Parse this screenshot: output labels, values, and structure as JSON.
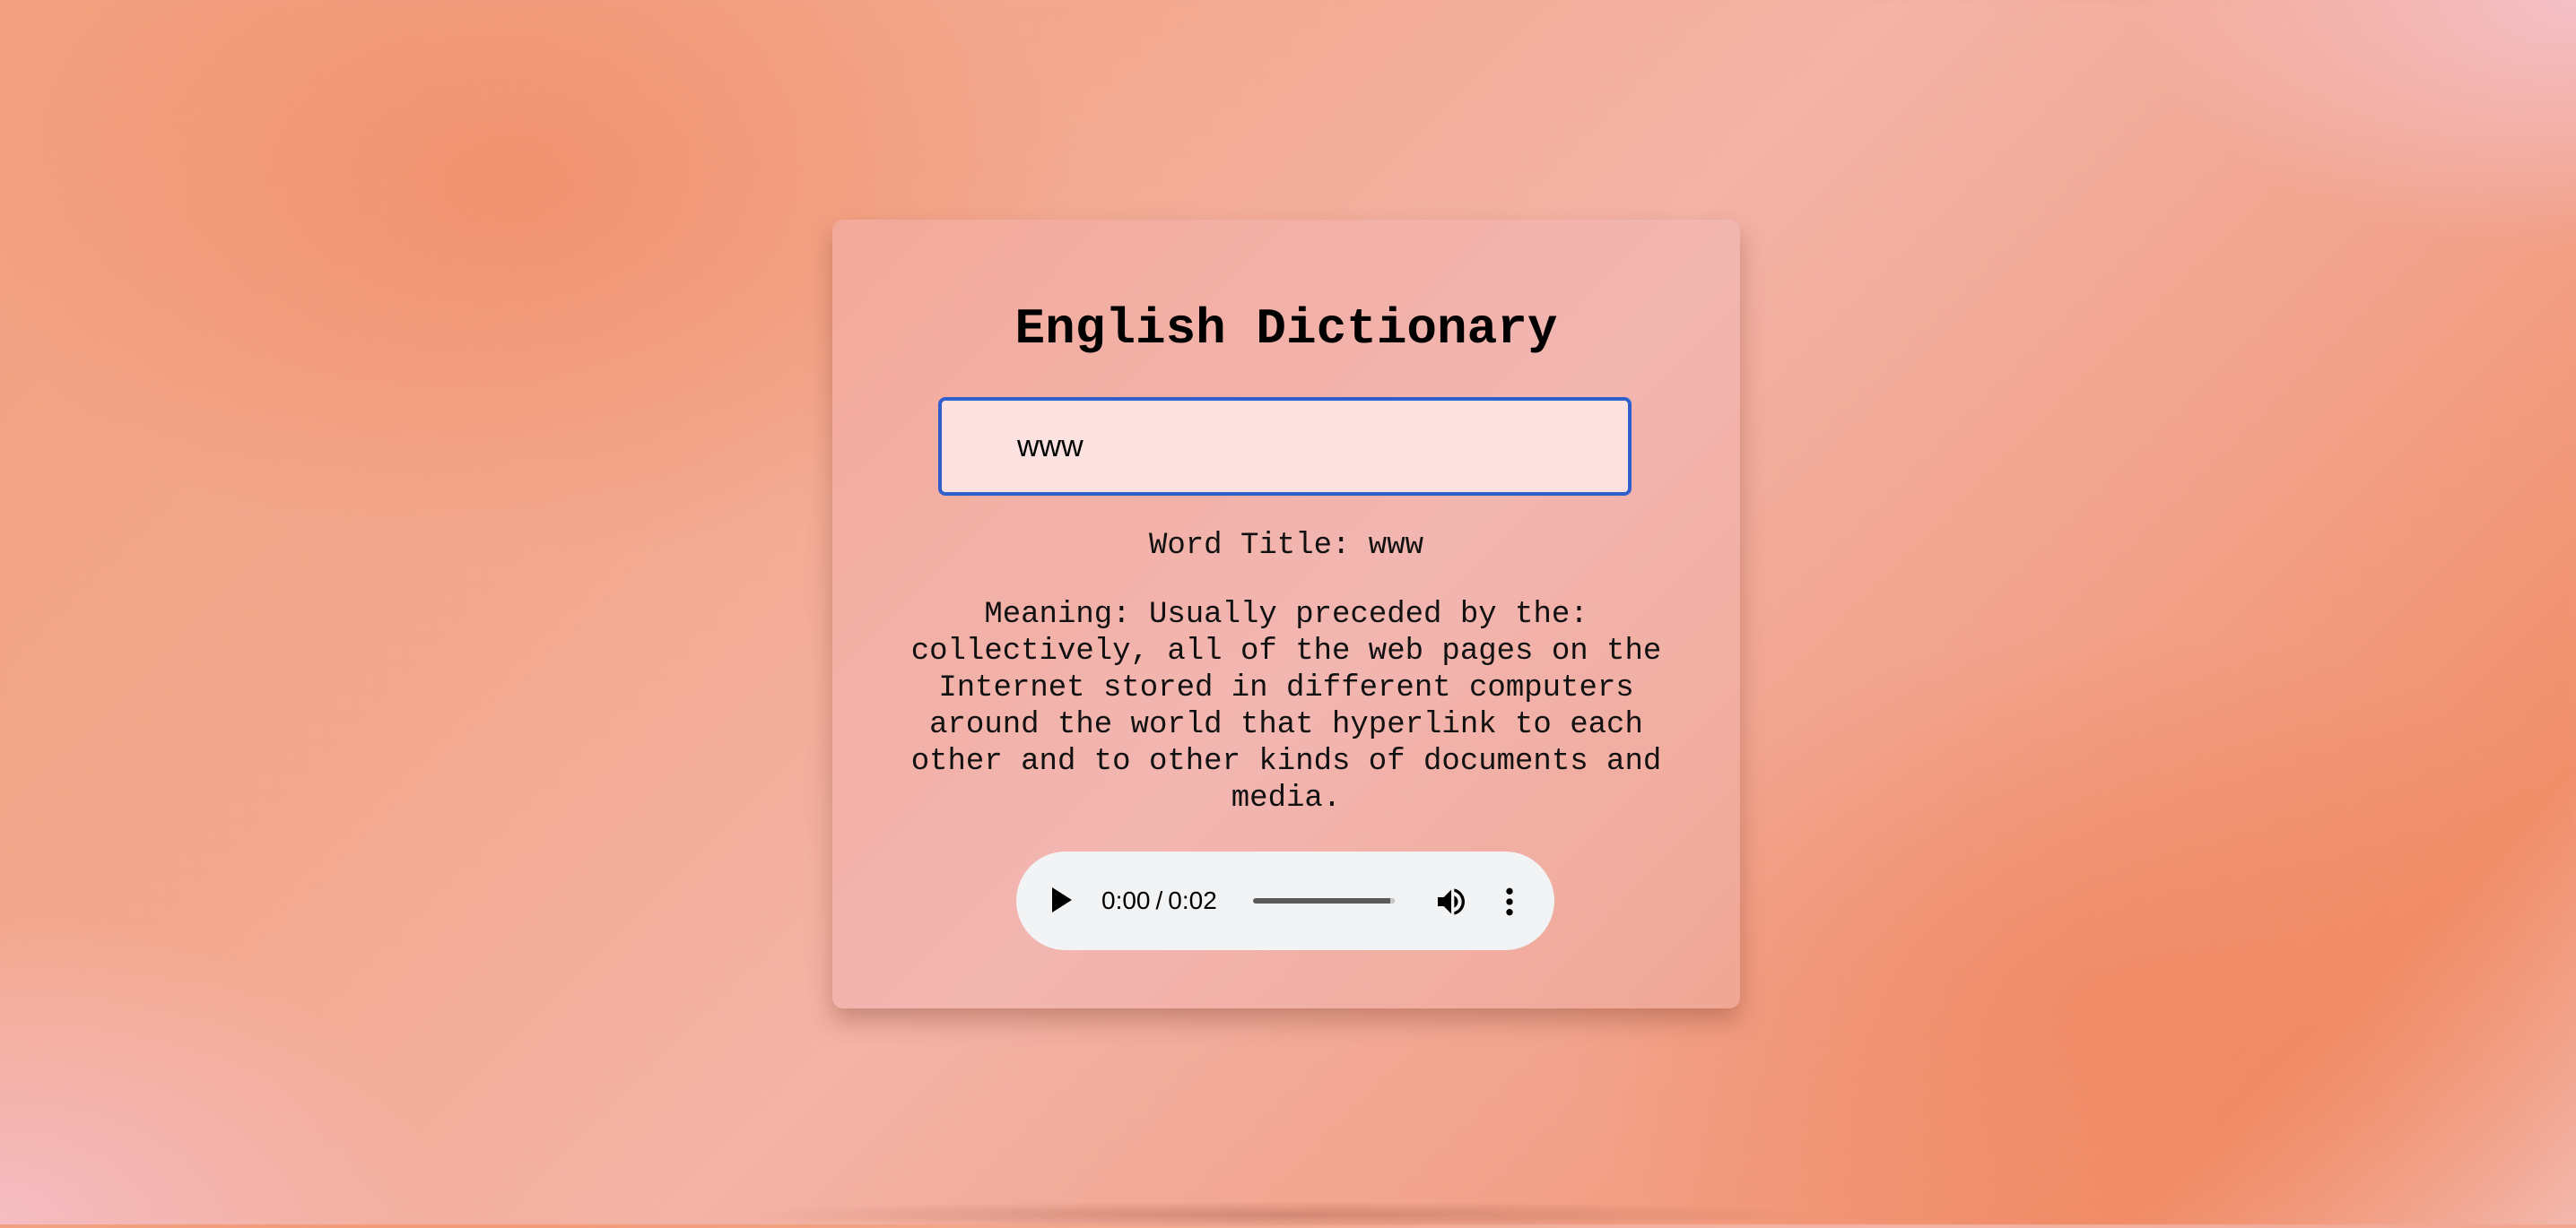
{
  "app": {
    "title": "English Dictionary"
  },
  "search": {
    "value": "www"
  },
  "result": {
    "word_title": "Word Title: www",
    "meaning": "Meaning: Usually preceded by the: collectively, all of the web pages on the Internet stored in different computers around the world that hyperlink to each other and to other kinds of documents and media."
  },
  "audio": {
    "current_time": "0:00",
    "separator": "/",
    "duration": "0:02",
    "progress": 0,
    "icons": {
      "play": "play-icon",
      "volume": "volume-icon",
      "more": "more-vertical-icon"
    }
  },
  "colors": {
    "input_border": "#2f5fcc",
    "input_background": "#fbe1df",
    "player_background": "#f1f3f4"
  }
}
